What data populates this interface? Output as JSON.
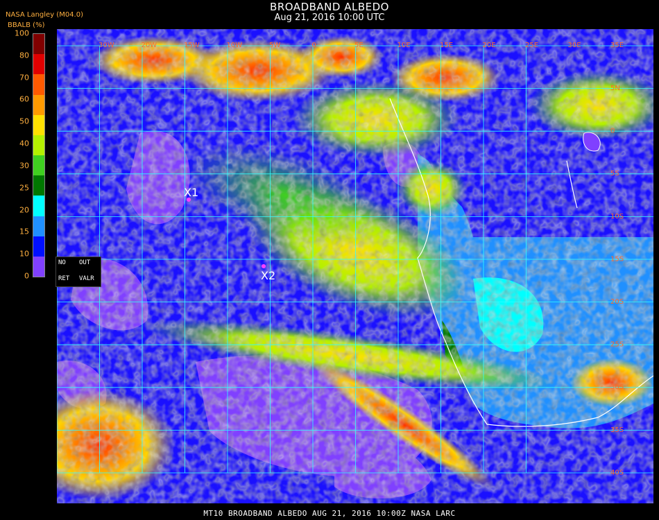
{
  "header": {
    "title": "BROADBAND ALBEDO",
    "subtitle": "Aug 21, 2016 10:00 UTC",
    "provider": "NASA Langley (M04.0)",
    "unit": "BBALB (%)"
  },
  "colorbar": {
    "ticks": [
      "100",
      "80",
      "70",
      "60",
      "50",
      "40",
      "30",
      "25",
      "20",
      "15",
      "10",
      "0"
    ],
    "colors": [
      "#800000",
      "#e00000",
      "#ff5a00",
      "#ff9a00",
      "#ffe000",
      "#b4f000",
      "#40d020",
      "#007800",
      "#00ffff",
      "#2090ff",
      "#0010ff",
      "#8040ff"
    ]
  },
  "legend": {
    "no": "NO",
    "out": "OUT",
    "ret": "RET",
    "valr": "VALR"
  },
  "map": {
    "top_lon_labels": [
      "30W",
      "20W",
      "15W",
      "10W",
      "5W",
      "0",
      "5E",
      "10E",
      "15E",
      "20E",
      "25E",
      "30E",
      "35E"
    ],
    "right_lat_labels": [
      "5N",
      "0",
      "5S",
      "10S",
      "15S",
      "20S",
      "25S",
      "30S",
      "35S",
      "40S"
    ],
    "markers": [
      {
        "label": "X1",
        "color": "#ff40ff"
      },
      {
        "label": "X2",
        "color": "#ff40ff"
      }
    ],
    "grid_color": "#30ffff",
    "coast_color": "#ffffff",
    "label_color": "#ff6a2a"
  },
  "footer": {
    "text": "MT10  BROADBAND ALBEDO   AUG 21, 2016 10:00Z   NASA LARC"
  }
}
